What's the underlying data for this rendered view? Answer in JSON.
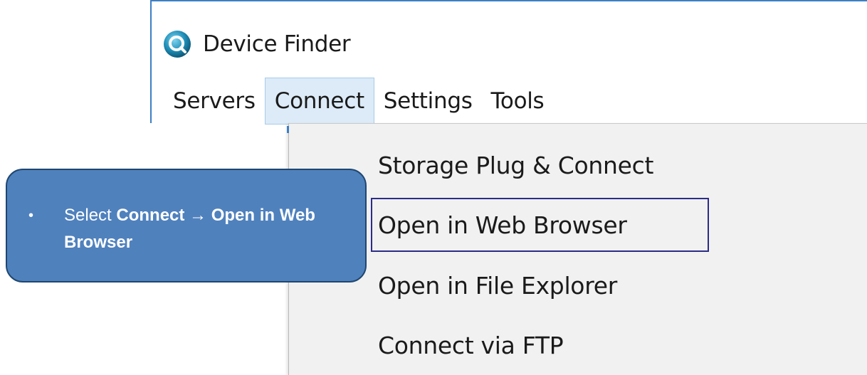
{
  "window": {
    "title": "Device Finder",
    "icon": "device-finder-app-icon"
  },
  "menubar": {
    "items": [
      {
        "label": "Servers"
      },
      {
        "label": "Connect"
      },
      {
        "label": "Settings"
      },
      {
        "label": "Tools"
      }
    ],
    "active_index": 1
  },
  "dropdown": {
    "items": [
      {
        "label": "Storage Plug & Connect"
      },
      {
        "label": "Open in Web Browser"
      },
      {
        "label": "Open in File Explorer"
      },
      {
        "label": "Connect via FTP"
      }
    ],
    "highlighted_index": 1
  },
  "callout": {
    "bullet": "•",
    "prefix": "Select ",
    "bold_part_1": "Connect",
    "arrow": "→",
    "bold_part_2": "Open in Web Browser"
  },
  "colors": {
    "window_border": "#3d7fc4",
    "active_menu_bg": "#dcebf7",
    "dropdown_bg": "#f1f1f1",
    "highlight_border": "#2c2c88",
    "callout_bg": "#4f81bd",
    "callout_border": "#1f4770"
  }
}
